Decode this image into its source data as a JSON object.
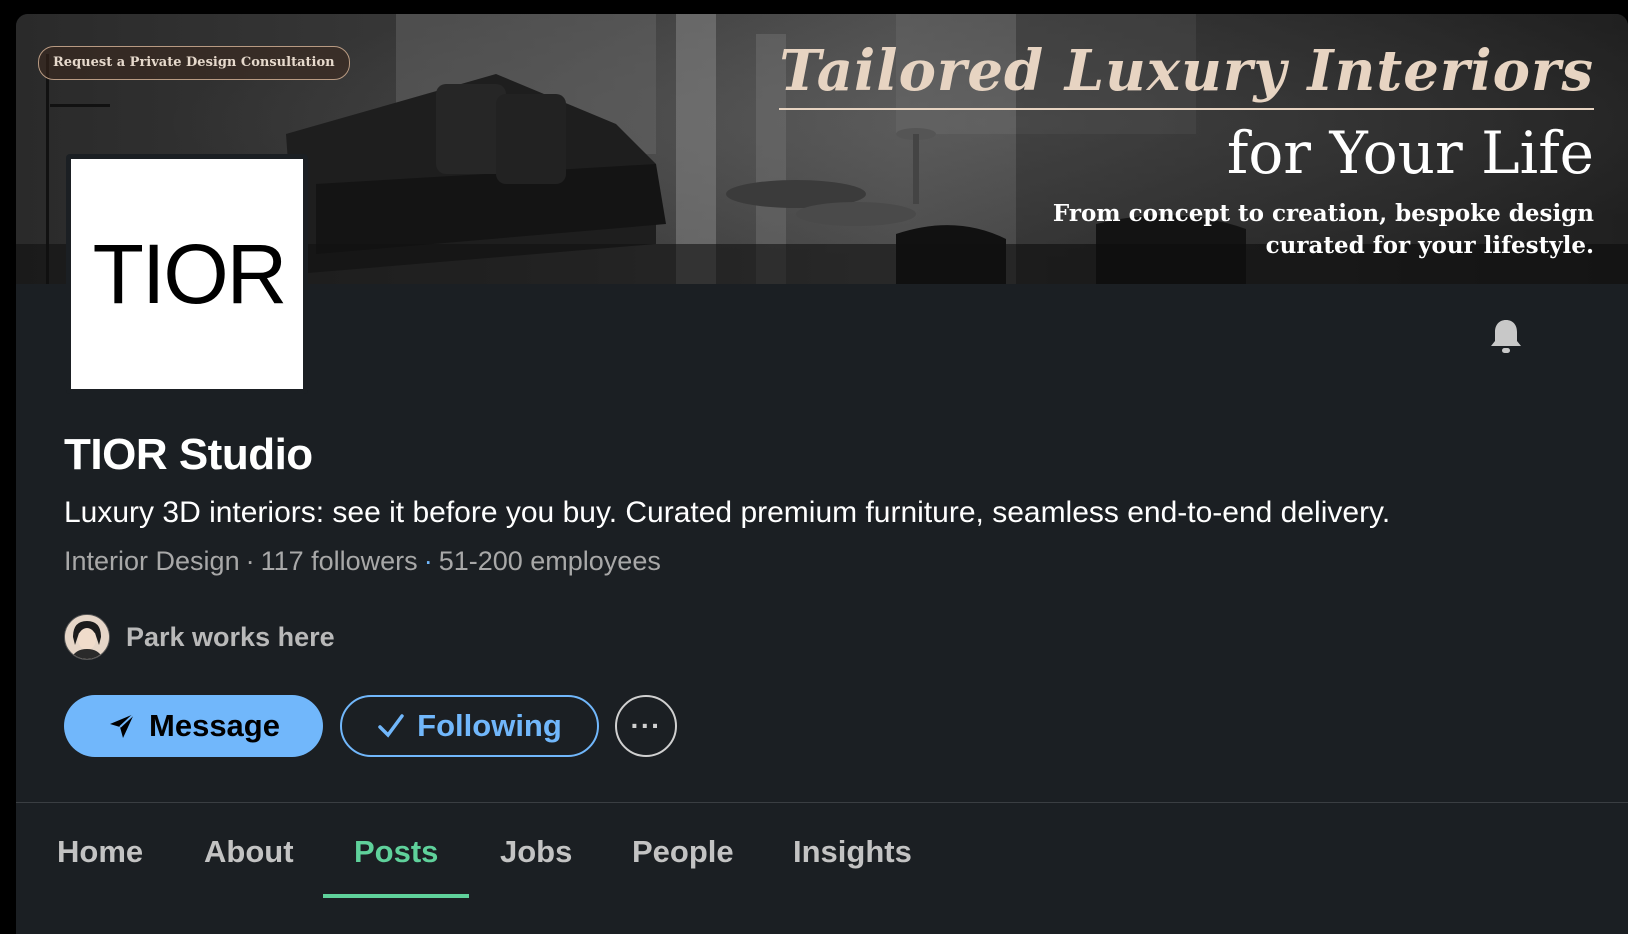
{
  "banner": {
    "consultation_button": "Request a Private Design Consultation",
    "headline": "Tailored Luxury Interiors",
    "subheadline": "for Your Life",
    "tagline_line1": "From concept to creation, bespoke design",
    "tagline_line2": "curated for your lifestyle."
  },
  "company": {
    "logo_text": "TIOR",
    "name": "TIOR Studio",
    "tagline": "Luxury 3D interiors: see it before you buy. Curated premium furniture, seamless end-to-end delivery.",
    "industry": "Interior Design",
    "followers": "117 followers",
    "employees": "51-200 employees",
    "works_here": "Park works here"
  },
  "actions": {
    "message_label": "Message",
    "following_label": "Following",
    "more_label": "···"
  },
  "tabs": [
    {
      "label": "Home",
      "active": false
    },
    {
      "label": "About",
      "active": false
    },
    {
      "label": "Posts",
      "active": true
    },
    {
      "label": "Jobs",
      "active": false
    },
    {
      "label": "People",
      "active": false
    },
    {
      "label": "Insights",
      "active": false
    }
  ],
  "colors": {
    "background": "#1b1f23",
    "accent_blue": "#71b7fb",
    "active_tab_green": "#5fd19b",
    "banner_headline": "#e7d4c2"
  },
  "icons": {
    "bell": "bell-icon",
    "message": "paper-plane-icon",
    "following": "checkmark-icon",
    "more": "ellipsis-icon"
  }
}
